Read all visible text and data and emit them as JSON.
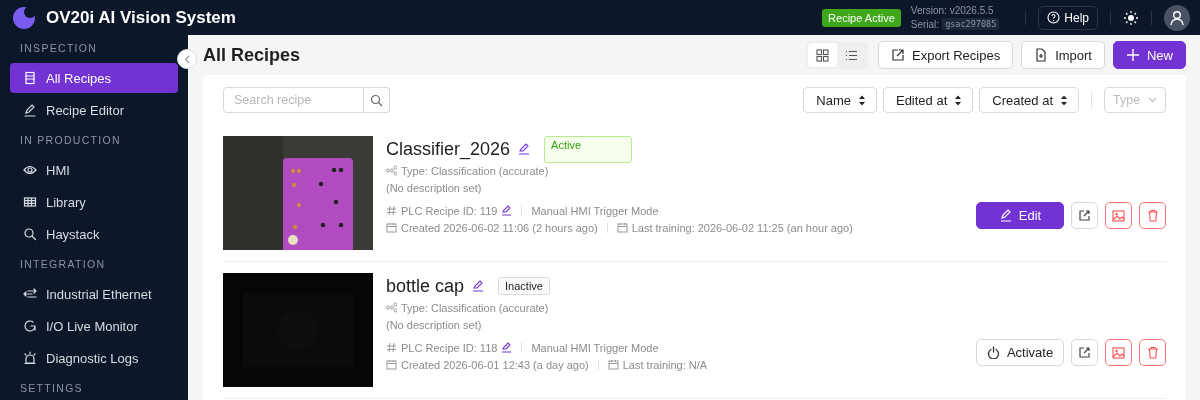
{
  "header": {
    "title": "OV20i AI Vision System",
    "status": "Recipe Active",
    "version": "Version: v2026.5.5",
    "serial_label": "Serial:",
    "serial": "gsac297085",
    "help": "Help"
  },
  "sidebar": {
    "sections": [
      {
        "heading": "INSPECTION",
        "items": [
          {
            "label": "All Recipes",
            "selected": true
          },
          {
            "label": "Recipe Editor",
            "selected": false
          }
        ]
      },
      {
        "heading": "IN PRODUCTION",
        "items": [
          {
            "label": "HMI",
            "selected": false
          },
          {
            "label": "Library",
            "selected": false
          },
          {
            "label": "Haystack",
            "selected": false
          }
        ]
      },
      {
        "heading": "INTEGRATION",
        "items": [
          {
            "label": "Industrial Ethernet",
            "selected": false
          },
          {
            "label": "I/O Live Monitor",
            "selected": false
          },
          {
            "label": "Diagnostic Logs",
            "selected": false
          }
        ]
      },
      {
        "heading": "SETTINGS"
      }
    ]
  },
  "page": {
    "title": "All Recipes",
    "views": [
      {
        "kind": "grid",
        "selected": true
      },
      {
        "kind": "list",
        "selected": false
      }
    ],
    "actions": [
      {
        "kind": "export",
        "label": "Export Recipes"
      },
      {
        "kind": "import",
        "label": "Import"
      },
      {
        "kind": "new",
        "label": "New"
      }
    ]
  },
  "filters": {
    "search_placeholder": "Search recipe",
    "sorts": [
      "Name",
      "Edited at",
      "Created at"
    ],
    "type_placeholder": "Type"
  },
  "recipes": [
    {
      "name": "Classifier_2026",
      "active": true,
      "status": "Active",
      "type": "Type: Classification (accurate)",
      "description": "(No description set)",
      "plc_id": "PLC Recipe ID: 119",
      "trigger": "Manual HMI Trigger Mode",
      "created": "Created 2026-06-02 11:06 (2 hours ago)",
      "last_training": "Last training: 2026-06-02 11:25 (an hour ago)",
      "action": {
        "kind": "edit",
        "label": "Edit"
      }
    },
    {
      "name": "bottle cap",
      "active": false,
      "status": "Inactive",
      "type": "Type: Classification (accurate)",
      "description": "(No description set)",
      "plc_id": "PLC Recipe ID: 118",
      "trigger": "Manual HMI Trigger Mode",
      "created": "Created 2026-06-01 12:43 (a day ago)",
      "last_training": "Last training: N/A",
      "action": {
        "kind": "activate",
        "label": "Activate"
      }
    }
  ]
}
